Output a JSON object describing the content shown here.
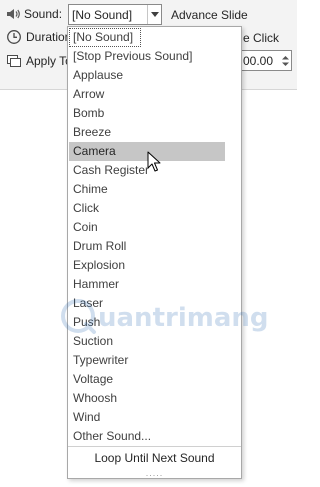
{
  "ribbon": {
    "sound_label": "Sound:",
    "sound_value": "[No Sound]",
    "duration_label": "Duration",
    "apply_label": "Apply To",
    "advance_label": "Advance Slide",
    "on_click_label": "e Click",
    "time_value": "00.00"
  },
  "dropdown": {
    "items": [
      "[No Sound]",
      "[Stop Previous Sound]",
      "Applause",
      "Arrow",
      "Bomb",
      "Breeze",
      "Camera",
      "Cash Register",
      "Chime",
      "Click",
      "Coin",
      "Drum Roll",
      "Explosion",
      "Hammer",
      "Laser",
      "Push",
      "Suction",
      "Typewriter",
      "Voltage",
      "Whoosh",
      "Wind",
      "Other Sound..."
    ],
    "selected_item": "Camera",
    "current_item": "[No Sound]",
    "loop_label": "Loop Until Next Sound",
    "grip": "....."
  },
  "watermark": {
    "text": "uantrimang"
  },
  "icons": {
    "sound": "speaker-icon",
    "duration": "clock-icon",
    "apply": "apply-to-all-icon",
    "dropdown_arrow": "chevron-down-icon",
    "cursor": "mouse-pointer-icon"
  }
}
